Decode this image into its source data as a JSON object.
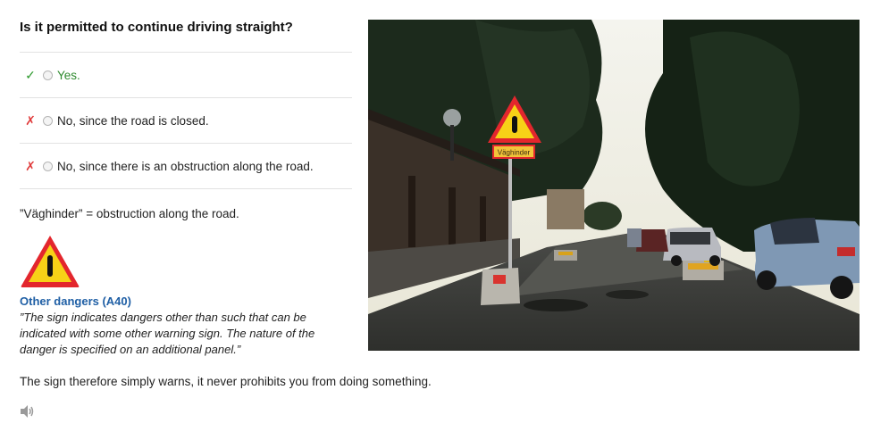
{
  "question": "Is it permitted to continue driving straight?",
  "answers": [
    {
      "mark": "✓",
      "label": "Yes.",
      "correct": true
    },
    {
      "mark": "✗",
      "label": "No, since the road is closed.",
      "correct": false
    },
    {
      "mark": "✗",
      "label": "No, since there is an obstruction along the road.",
      "correct": false
    }
  ],
  "explanation": "”Väghinder” = obstruction along the road.",
  "sign": {
    "title": "Other dangers (A40)",
    "quote": "”The sign indicates dangers other than such that can be indicated with some other warning sign. The nature of the danger is specified on an additional panel.”"
  },
  "conclusion": "The sign therefore simply warns, it never prohibits you from doing something.",
  "photo": {
    "panel_text": "Väghinder"
  },
  "icons": {
    "correct": "check-icon",
    "wrong": "cross-icon",
    "audio": "speaker-icon",
    "sign": "warning-sign-icon"
  },
  "colors": {
    "correct": "#2e9a2e",
    "wrong": "#e03a3a",
    "link": "#1f5fa5",
    "sign_border": "#e3262d",
    "sign_fill": "#f7d117"
  }
}
